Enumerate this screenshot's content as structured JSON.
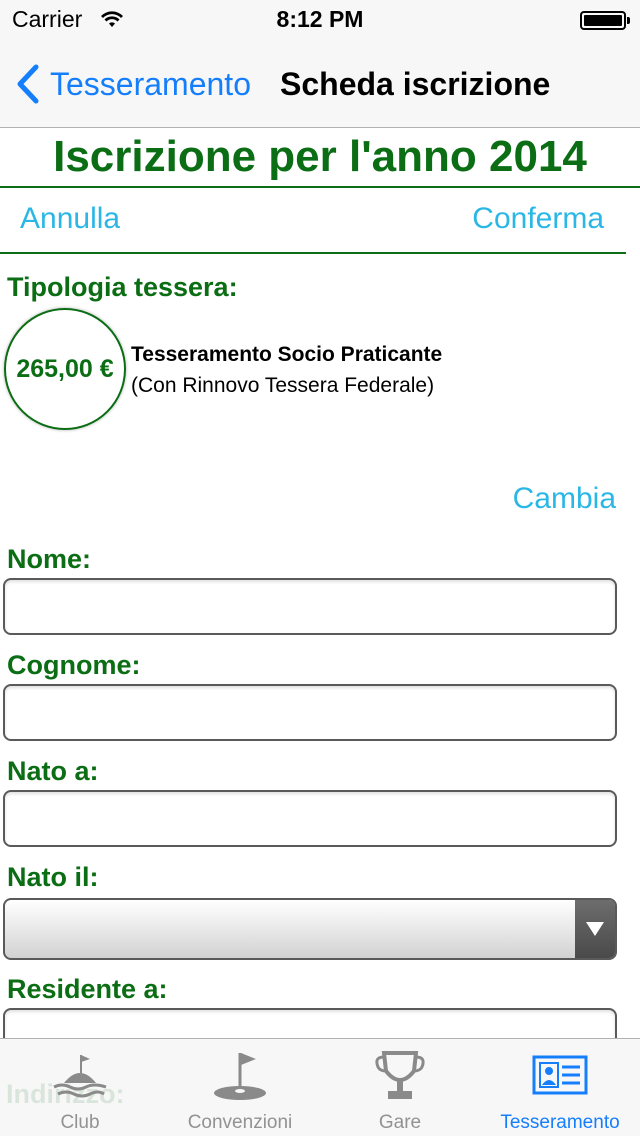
{
  "status_bar": {
    "carrier": "Carrier",
    "time": "8:12 PM"
  },
  "nav": {
    "back_label": "Tesseramento",
    "title": "Scheda iscrizione"
  },
  "page": {
    "title": "Iscrizione per l'anno 2014",
    "cancel_label": "Annulla",
    "confirm_label": "Conferma"
  },
  "tessera": {
    "section_label": "Tipologia tessera:",
    "price": "265,00 €",
    "name": "Tesseramento Socio Praticante",
    "description": "(Con Rinnovo Tessera Federale)",
    "change_label": "Cambia"
  },
  "form": {
    "nome_label": "Nome:",
    "nome_value": "",
    "cognome_label": "Cognome:",
    "cognome_value": "",
    "nato_a_label": "Nato a:",
    "nato_a_value": "",
    "nato_il_label": "Nato il:",
    "nato_il_value": "",
    "residente_label": "Residente a:",
    "residente_value": "",
    "indirizzo_label": "Indirizzo:"
  },
  "tab_bar": {
    "tabs": [
      {
        "label": "Club",
        "icon": "island-icon",
        "active": false
      },
      {
        "label": "Convenzioni",
        "icon": "golf-flag-icon",
        "active": false
      },
      {
        "label": "Gare",
        "icon": "trophy-icon",
        "active": false
      },
      {
        "label": "Tesseramento",
        "icon": "id-card-icon",
        "active": true
      }
    ]
  },
  "colors": {
    "green": "#0b6d14",
    "link_cyan": "#2ab7e6",
    "ios_blue": "#157efb",
    "tab_gray": "#929292"
  }
}
